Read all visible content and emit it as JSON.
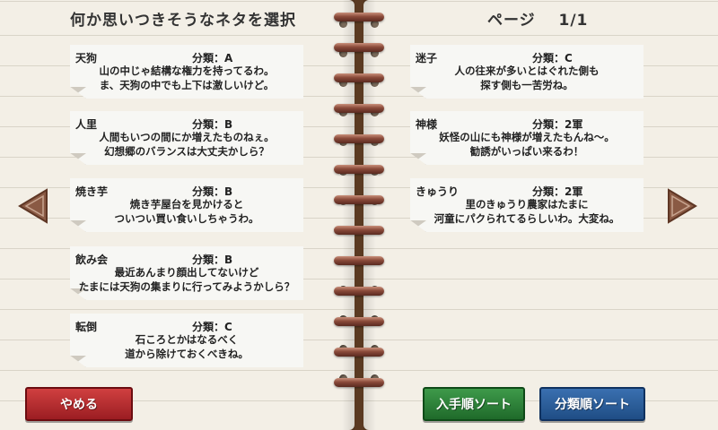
{
  "left_page": {
    "title": "何か思いつきそうなネタを選択",
    "items": [
      {
        "name": "天狗",
        "category": "分類：A",
        "line1": "山の中じゃ結構な権力を持ってるわ。",
        "line2": "ま、天狗の中でも上下は激しいけど。"
      },
      {
        "name": "人里",
        "category": "分類：B",
        "line1": "人間もいつの間にか増えたものねぇ。",
        "line2": "幻想郷のバランスは大丈夫かしら？"
      },
      {
        "name": "焼き芋",
        "category": "分類：B",
        "line1": "焼き芋屋台を見かけると",
        "line2": "ついつい買い食いしちゃうわ。"
      },
      {
        "name": "飲み会",
        "category": "分類：B",
        "line1": "最近あんまり顔出してないけど",
        "line2": "たまには天狗の集まりに行ってみようかしら？"
      },
      {
        "name": "転倒",
        "category": "分類：C",
        "line1": "石ころとかはなるべく",
        "line2": "道から除けておくべきね。"
      }
    ],
    "quit_button": "やめる"
  },
  "right_page": {
    "page_label": "ページ",
    "page_number": "1/1",
    "items": [
      {
        "name": "迷子",
        "category": "分類：C",
        "line1": "人の往来が多いとはぐれた側も",
        "line2": "探す側も一苦労ね。"
      },
      {
        "name": "神様",
        "category": "分類：2軍",
        "line1": "妖怪の山にも神様が増えたもんね～。",
        "line2": "勧誘がいっぱい来るわ！"
      },
      {
        "name": "きゅうり",
        "category": "分類：2軍",
        "line1": "里のきゅうり農家はたまに",
        "line2": "河童にパクられてるらしいわ。大変ね。"
      }
    ],
    "sort_acquired_button": "入手順ソート",
    "sort_category_button": "分類順ソート"
  },
  "icons": {
    "prev": "left-triangle-arrow-icon",
    "next": "right-triangle-arrow-icon",
    "binding": "spiral-ring-icon"
  },
  "colors": {
    "quit": "#b8282d",
    "sort_acquired": "#2e8a3c",
    "sort_category": "#2f63a0",
    "paper": "#f3efe6",
    "arrow": "#7a4a36"
  }
}
